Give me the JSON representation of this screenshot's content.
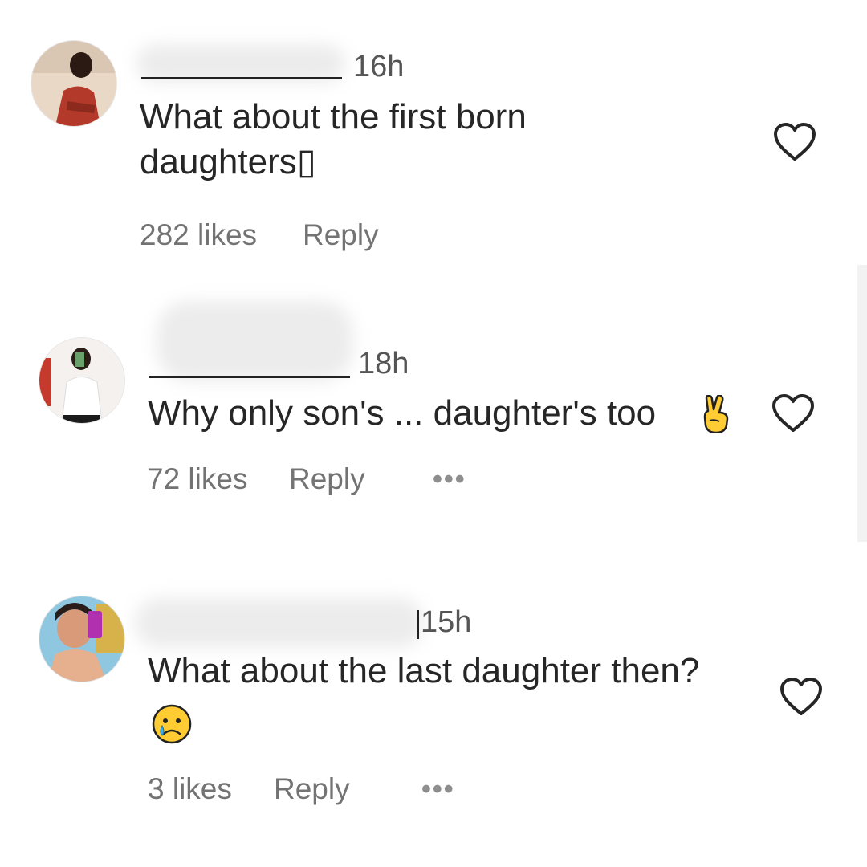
{
  "comments": [
    {
      "time": "16h",
      "text": "What about the first born\ndaughters▯",
      "likes": "282 likes",
      "reply": "Reply"
    },
    {
      "time": "18h",
      "text": "Why only son's ... daughter's too",
      "likes": "72 likes",
      "reply": "Reply",
      "more": "•••",
      "emoji": "victory-hand"
    },
    {
      "time": "15h",
      "text": "What about the last daughter then?",
      "likes": "3 likes",
      "reply": "Reply",
      "more": "•••",
      "emoji": "crying-face"
    }
  ],
  "colors": {
    "text": "#262626",
    "muted": "#737373",
    "heart_stroke": "#262626"
  }
}
